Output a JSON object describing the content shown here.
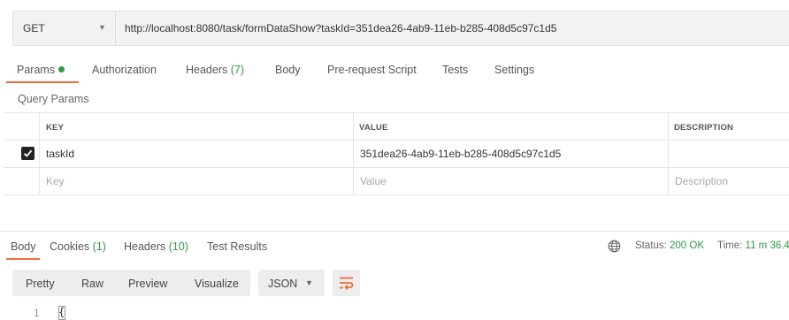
{
  "request": {
    "method": "GET",
    "url": "http://localhost:8080/task/formDataShow?taskId=351dea26-4ab9-11eb-b285-408d5c97c1d5"
  },
  "request_tabs": [
    {
      "label": "Params",
      "active": true
    },
    {
      "label": "Authorization"
    },
    {
      "label": "Headers",
      "count": "(7)"
    },
    {
      "label": "Body"
    },
    {
      "label": "Pre-request Script"
    },
    {
      "label": "Tests"
    },
    {
      "label": "Settings"
    }
  ],
  "query_params": {
    "title": "Query Params",
    "headers": {
      "key": "KEY",
      "value": "VALUE",
      "description": "DESCRIPTION"
    },
    "rows": [
      {
        "checked": true,
        "key": "taskId",
        "value": "351dea26-4ab9-11eb-b285-408d5c97c1d5",
        "description": ""
      }
    ],
    "placeholders": {
      "key": "Key",
      "value": "Value",
      "description": "Description"
    }
  },
  "response_tabs": [
    {
      "label": "Body",
      "active": true
    },
    {
      "label": "Cookies",
      "count": "(1)"
    },
    {
      "label": "Headers",
      "count": "(10)"
    },
    {
      "label": "Test Results"
    }
  ],
  "status": {
    "label": "Status:",
    "value": "200 OK",
    "time_label": "Time:",
    "time_value": "11 m 36.4"
  },
  "view_modes": [
    "Pretty",
    "Raw",
    "Preview",
    "Visualize"
  ],
  "active_view_mode": "Pretty",
  "format": "JSON",
  "code_lines": [
    {
      "number": "1",
      "text": "{"
    }
  ],
  "colors": {
    "accent": "#f26b3a",
    "success": "#2f9a4a"
  },
  "icons": [
    "chevron-down-icon",
    "checkmark-icon",
    "globe-icon",
    "wrap-lines-icon"
  ]
}
